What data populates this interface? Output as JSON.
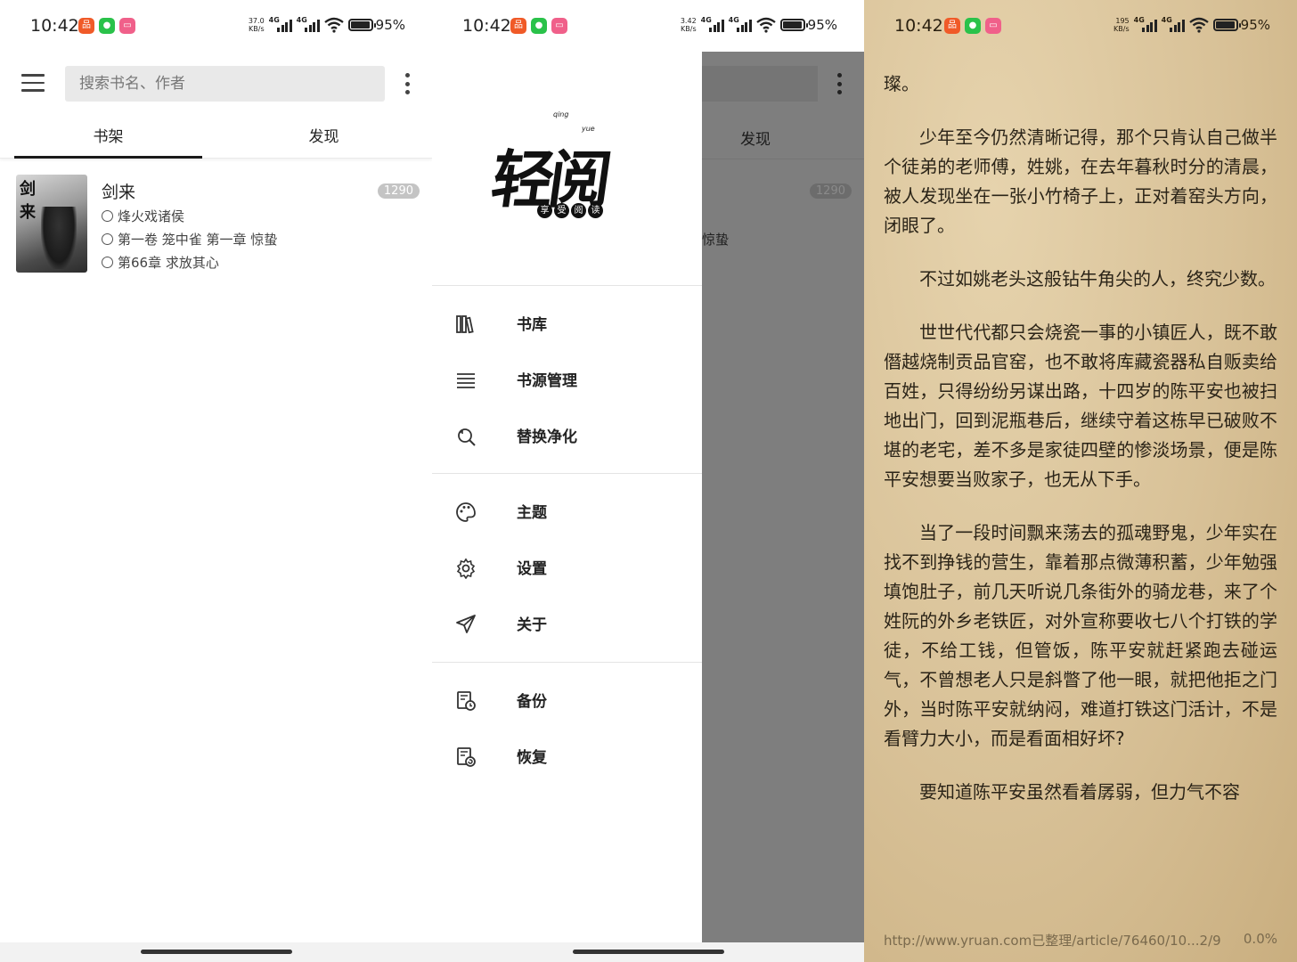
{
  "status": {
    "time": "10:42",
    "battery": "95%",
    "speed1": "37.0",
    "speed2": "3.42",
    "speed3": "195",
    "kbs": "KB/s",
    "net": "4G"
  },
  "bookshelf": {
    "search_placeholder": "搜索书名、作者",
    "tabs": [
      "书架",
      "发现"
    ],
    "book": {
      "title": "剑来",
      "author": "烽火戏诸侯",
      "progress": "第一卷 笼中雀 第一章 惊蛰",
      "latest": "第66章 求放其心",
      "badge": "1290",
      "cover_text": "剑来"
    }
  },
  "drawer": {
    "logo": "轻阅",
    "logo_sub": [
      "享",
      "受",
      "阅",
      "读"
    ],
    "logo_tiny1": "qing",
    "logo_tiny2": "yue",
    "items": [
      {
        "label": "书库",
        "icon": "library-icon"
      },
      {
        "label": "书源管理",
        "icon": "list-icon"
      },
      {
        "label": "替换净化",
        "icon": "find-replace-icon"
      },
      {
        "label": "主题",
        "icon": "palette-icon"
      },
      {
        "label": "设置",
        "icon": "gear-icon"
      },
      {
        "label": "关于",
        "icon": "send-icon"
      },
      {
        "label": "备份",
        "icon": "backup-icon"
      },
      {
        "label": "恢复",
        "icon": "restore-icon"
      }
    ],
    "dim_tab": "发现",
    "dim_badge": "1290",
    "dim_text": "惊蛰"
  },
  "reader": {
    "paragraphs": [
      "璨。",
      "少年至今仍然清晰记得，那个只肯认自己做半个徒弟的老师傅，姓姚，在去年暮秋时分的清晨，被人发现坐在一张小竹椅子上，正对着窑头方向，闭眼了。",
      "不过如姚老头这般钻牛角尖的人，终究少数。",
      "世世代代都只会烧瓷一事的小镇匠人，既不敢僭越烧制贡品官窑，也不敢将库藏瓷器私自贩卖给百姓，只得纷纷另谋出路，十四岁的陈平安也被扫地出门，回到泥瓶巷后，继续守着这栋早已破败不堪的老宅，差不多是家徒四壁的惨淡场景，便是陈平安想要当败家子，也无从下手。",
      "当了一段时间飘来荡去的孤魂野鬼，少年实在找不到挣钱的营生，靠着那点微薄积蓄，少年勉强填饱肚子，前几天听说几条街外的骑龙巷，来了个姓阮的外乡老铁匠，对外宣称要收七八个打铁的学徒，不给工钱，但管饭，陈平安就赶紧跑去碰运气，不曾想老人只是斜瞥了他一眼，就把他拒之门外，当时陈平安就纳闷，难道打铁这门活计，不是看臂力大小，而是看面相好坏?",
      "要知道陈平安虽然看着孱弱，但力气不容"
    ],
    "footer_url": "http://www.yruan.com已整理/article/76460/10...2/9",
    "footer_progress": "0.0%"
  }
}
